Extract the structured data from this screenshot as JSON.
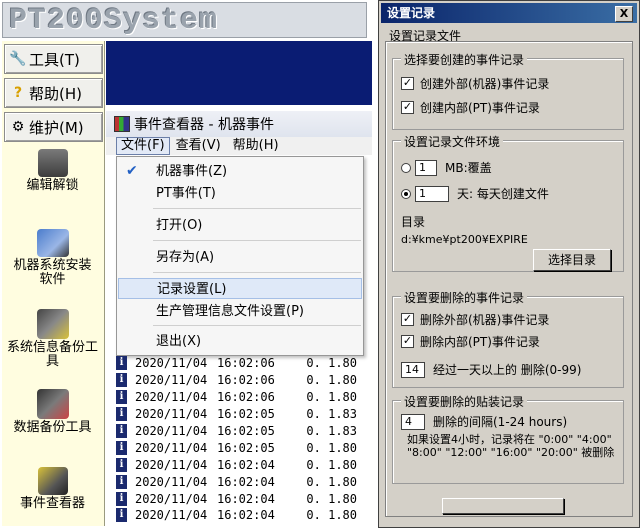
{
  "app": {
    "logo_text": "PT200System",
    "menus": [
      {
        "label": "工具(T)",
        "icon": "tools-icon"
      },
      {
        "label": "帮助(H)",
        "icon": "help-icon"
      },
      {
        "label": "维护(M)",
        "icon": "maintenance-icon"
      }
    ],
    "tools": [
      {
        "label": "编辑解锁",
        "icon": "edit-unlock-icon"
      },
      {
        "label": "机器系统安装软件",
        "icon": "install-software-icon"
      },
      {
        "label": "系统信息备份工具",
        "icon": "system-backup-icon"
      },
      {
        "label": "数据备份工具",
        "icon": "data-backup-icon"
      },
      {
        "label": "事件查看器",
        "icon": "event-viewer-icon"
      }
    ]
  },
  "event_viewer": {
    "title": "事件查看器 - 机器事件",
    "menubar": [
      "文件(F)",
      "查看(V)",
      "帮助(H)"
    ],
    "file_menu": {
      "items": [
        {
          "label": "机器事件(Z)",
          "checked": true
        },
        {
          "label": "PT事件(T)",
          "checked": false
        },
        {
          "label": "打开(O)",
          "checked": false
        },
        {
          "label": "另存为(A)",
          "checked": false
        },
        {
          "label": "记录设置(L)",
          "checked": false,
          "highlighted": true
        },
        {
          "label": "生产管理信息文件设置(P)",
          "checked": false
        },
        {
          "label": "退出(X)",
          "checked": false
        }
      ]
    },
    "log_rows": [
      {
        "date": "2020/11/04",
        "time": "16:02:06",
        "value": "0. 1.80"
      },
      {
        "date": "2020/11/04",
        "time": "16:02:06",
        "value": "0. 1.80"
      },
      {
        "date": "2020/11/04",
        "time": "16:02:06",
        "value": "0. 1.80"
      },
      {
        "date": "2020/11/04",
        "time": "16:02:05",
        "value": "0. 1.83"
      },
      {
        "date": "2020/11/04",
        "time": "16:02:05",
        "value": "0. 1.83"
      },
      {
        "date": "2020/11/04",
        "time": "16:02:05",
        "value": "0. 1.80"
      },
      {
        "date": "2020/11/04",
        "time": "16:02:04",
        "value": "0. 1.80"
      },
      {
        "date": "2020/11/04",
        "time": "16:02:04",
        "value": "0. 1.80"
      },
      {
        "date": "2020/11/04",
        "time": "16:02:04",
        "value": "0. 1.80"
      },
      {
        "date": "2020/11/04",
        "time": "16:02:04",
        "value": "0. 1.80"
      }
    ]
  },
  "dialog": {
    "title": "设置记录",
    "close_label": "X",
    "tab_label": "设置记录文件",
    "create_group": {
      "legend": "选择要创建的事件记录",
      "external": {
        "label": "创建外部(机器)事件记录",
        "checked": true
      },
      "internal": {
        "label": "创建内部(PT)事件记录",
        "checked": true
      }
    },
    "env_group": {
      "legend": "设置记录文件环境",
      "overwrite": {
        "value": "1",
        "suffix": "MB:覆盖",
        "selected": false
      },
      "daily": {
        "value": "1",
        "suffix": "天: 每天创建文件",
        "selected": true
      },
      "dir_label": "目录",
      "dir_path": "d:¥kme¥pt200¥EXPIRE",
      "select_dir_button": "选择目录"
    },
    "delete_group": {
      "legend": "设置要删除的事件记录",
      "external": {
        "label": "删除外部(机器)事件记录",
        "checked": true
      },
      "internal": {
        "label": "删除内部(PT)事件记录",
        "checked": true
      },
      "days_value": "14",
      "days_suffix": "经过一天以上的 删除(0-99)"
    },
    "mount_group": {
      "legend": "设置要删除的贴装记录",
      "interval_value": "4",
      "interval_suffix": "删除的间隔(1-24 hours)",
      "note": "如果设置4小时，记录将在 \"0:00\" \"4:00\" \"8:00\" \"12:00\" \"16:00\" \"20:00\" 被删除"
    }
  }
}
